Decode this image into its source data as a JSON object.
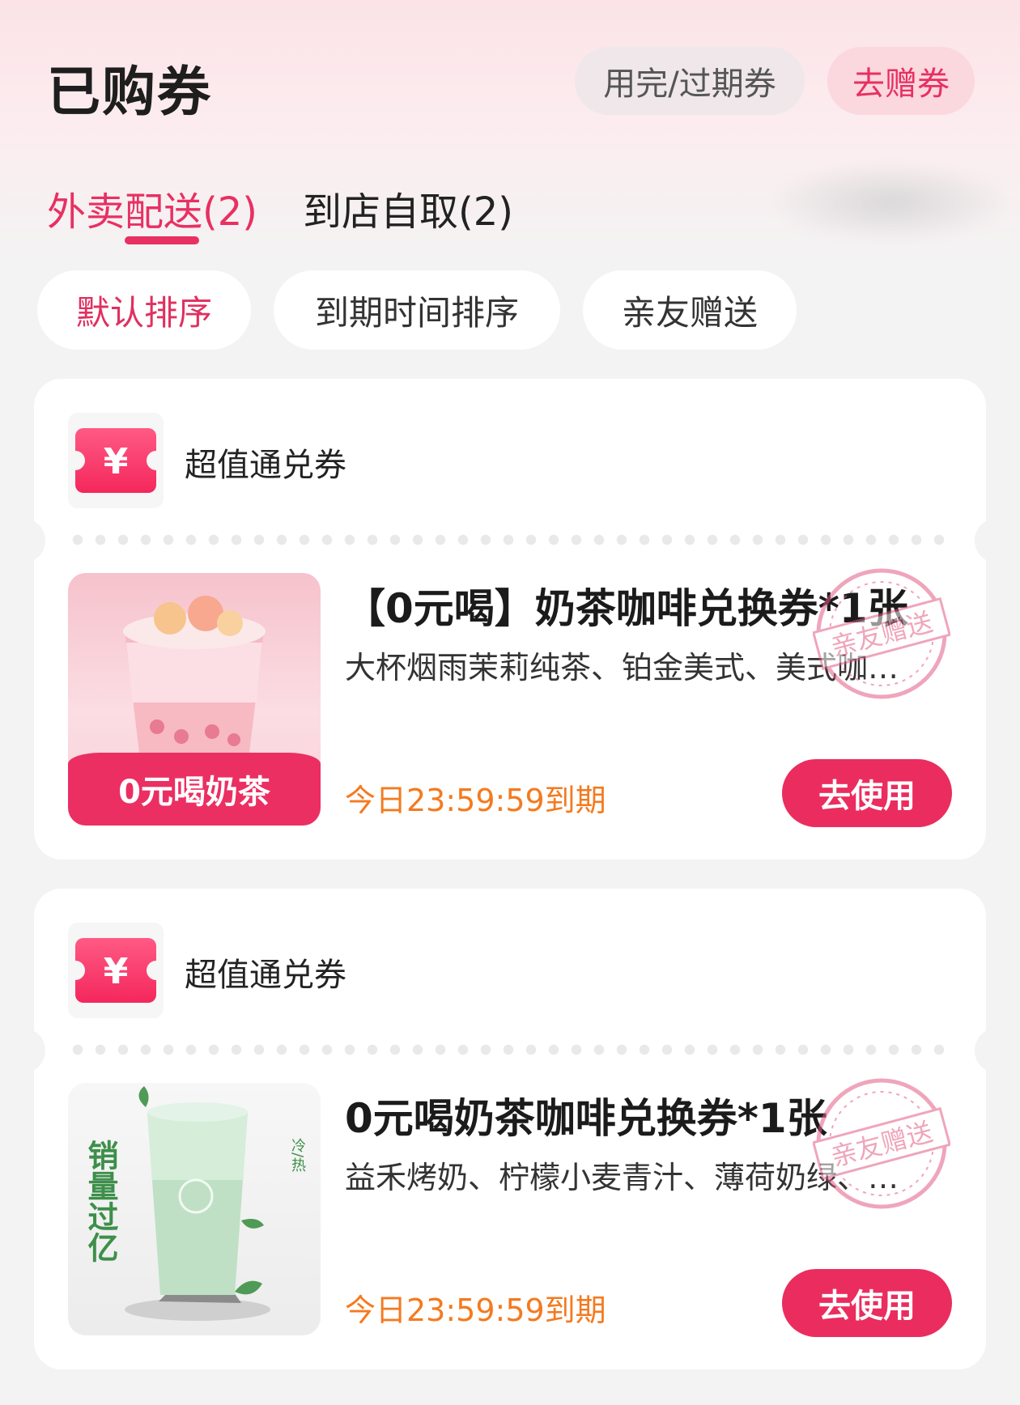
{
  "header": {
    "title": "已购券",
    "expired_button": "用完/过期券",
    "gift_button": "去赠券"
  },
  "tabs": [
    {
      "label": "外卖配送(2)",
      "active": true
    },
    {
      "label": "到店自取(2)",
      "active": false
    }
  ],
  "sort_chips": [
    {
      "label": "默认排序",
      "active": true
    },
    {
      "label": "到期时间排序",
      "active": false
    },
    {
      "label": "亲友赠送",
      "active": false
    }
  ],
  "colors": {
    "accent": "#e83062",
    "expire": "#f47a1f",
    "background": "#f3f3f3"
  },
  "coupons": [
    {
      "type_label": "超值通兑券",
      "type_icon": "yen-ticket-icon",
      "image_banner": "0元喝奶茶",
      "title": "【0元喝】奶茶咖啡兑换券*1张",
      "description": "大杯烟雨茉莉纯茶、铂金美式、美式咖…",
      "stamp_text": "亲友赠送",
      "expire": "今日23:59:59到期",
      "action": "去使用"
    },
    {
      "type_label": "超值通兑券",
      "type_icon": "yen-ticket-icon",
      "image_side_text": "销量过亿",
      "image_small_text": "冷/热",
      "title": "0元喝奶茶咖啡兑换券*1张",
      "description": "益禾烤奶、柠檬小麦青汁、薄荷奶绿、…",
      "stamp_text": "亲友赠送",
      "expire": "今日23:59:59到期",
      "action": "去使用"
    }
  ]
}
